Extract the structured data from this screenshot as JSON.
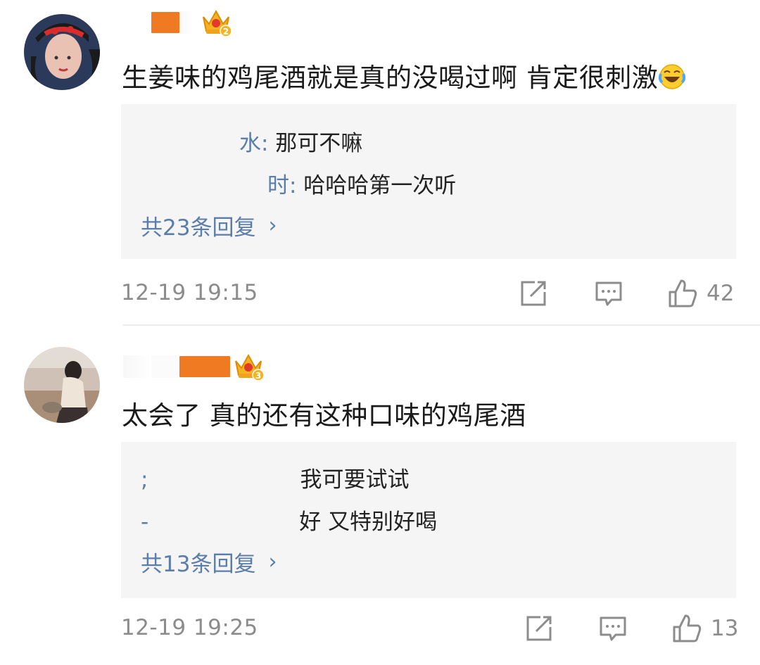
{
  "comments": [
    {
      "text": "生姜味的鸡尾酒就是真的没喝过啊 肯定很刺激",
      "badge_level": "2",
      "replies": [
        {
          "name": "水",
          "sep": ":",
          "text": " 那可不嘛"
        },
        {
          "name": "时",
          "sep": ":",
          "text": " 哈哈哈第一次听"
        }
      ],
      "more_replies": "共23条回复",
      "timestamp": "12-19 19:15",
      "likes": "42"
    },
    {
      "text": "太会了 真的还有这种口味的鸡尾酒",
      "badge_level": "3",
      "replies": [
        {
          "name": ";",
          "text": "我可要试试"
        },
        {
          "name": "-",
          "text": "好 又特别好喝"
        }
      ],
      "more_replies": "共13条回复",
      "timestamp": "12-19 19:25",
      "likes": "13"
    }
  ],
  "icons": {
    "share": "share-icon",
    "comment": "comment-icon",
    "like": "thumbs-up-icon",
    "crown": "crown-icon",
    "emoji": "laughing-crying-emoji-icon"
  },
  "colors": {
    "reply_name": "#5b7daa",
    "timestamp": "#8c8c8c",
    "name_mask": "#f07a22",
    "reply_bg": "#f5f5f5"
  }
}
